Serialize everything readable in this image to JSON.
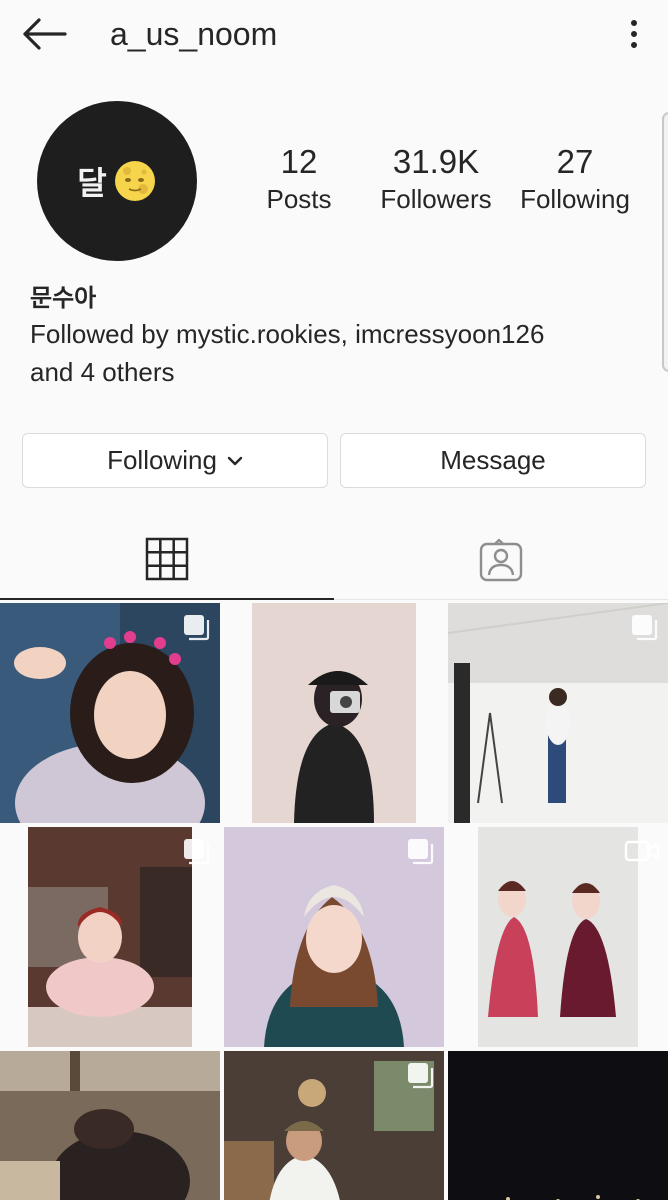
{
  "header": {
    "back_icon": "arrow-left-icon",
    "username": "a_us_noom",
    "more_icon": "vertical-dots-icon"
  },
  "profile": {
    "avatar_text": "달",
    "avatar_emoji": "moon-face-icon",
    "display_name": "문수아",
    "followed_by": "Followed by mystic.rookies, imcressyoon126 and 4 others"
  },
  "stats": {
    "posts": {
      "value": "12",
      "label": "Posts"
    },
    "followers": {
      "value": "31.9K",
      "label": "Followers"
    },
    "following": {
      "value": "27",
      "label": "Following"
    }
  },
  "actions": {
    "following_label": "Following",
    "message_label": "Message"
  },
  "tabs": [
    {
      "icon": "grid-icon",
      "active": true
    },
    {
      "icon": "tagged-person-icon",
      "active": false
    }
  ],
  "colors": {
    "background": "#fafafa",
    "text": "#262626",
    "border": "#dbdbdb"
  },
  "posts": [
    {
      "badge": "multiple-photos-icon"
    },
    {
      "badge": ""
    },
    {
      "badge": "multiple-photos-icon"
    },
    {
      "badge": "multiple-photos-icon"
    },
    {
      "badge": "multiple-photos-icon"
    },
    {
      "badge": "video-icon"
    },
    {
      "badge": ""
    },
    {
      "badge": "multiple-photos-icon"
    },
    {
      "badge": ""
    }
  ]
}
